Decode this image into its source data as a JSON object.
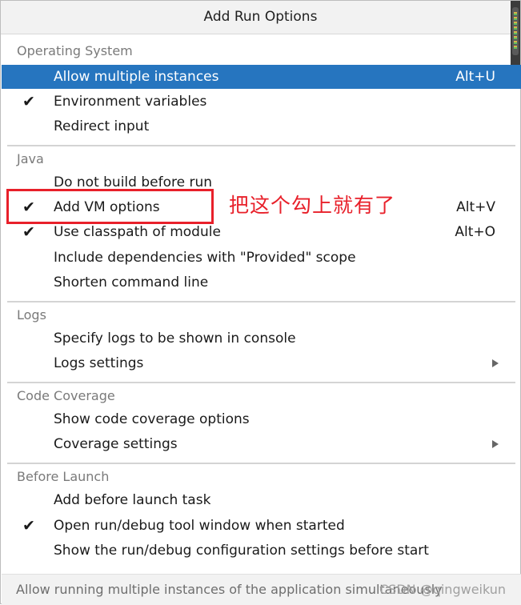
{
  "dialog": {
    "title": "Add Run Options"
  },
  "sections": [
    {
      "header": "Operating System",
      "items": [
        {
          "label": "Allow multiple instances",
          "shortcut": "Alt+U",
          "checked": false,
          "selected": true
        },
        {
          "label": "Environment variables",
          "shortcut": "",
          "checked": true
        },
        {
          "label": "Redirect input",
          "shortcut": "",
          "checked": false
        }
      ]
    },
    {
      "header": "Java",
      "items": [
        {
          "label": "Do not build before run",
          "shortcut": "",
          "checked": false
        },
        {
          "label": "Add VM options",
          "shortcut": "Alt+V",
          "checked": true
        },
        {
          "label": "Use classpath of module",
          "shortcut": "Alt+O",
          "checked": true
        },
        {
          "label": "Include dependencies with \"Provided\" scope",
          "shortcut": "",
          "checked": false
        },
        {
          "label": "Shorten command line",
          "shortcut": "",
          "checked": false
        }
      ]
    },
    {
      "header": "Logs",
      "items": [
        {
          "label": "Specify logs to be shown in console",
          "shortcut": "",
          "checked": false
        },
        {
          "label": "Logs settings",
          "shortcut": "",
          "checked": false,
          "submenu": true
        }
      ]
    },
    {
      "header": "Code Coverage",
      "items": [
        {
          "label": "Show code coverage options",
          "shortcut": "",
          "checked": false
        },
        {
          "label": "Coverage settings",
          "shortcut": "",
          "checked": false,
          "submenu": true
        }
      ]
    },
    {
      "header": "Before Launch",
      "items": [
        {
          "label": "Add before launch task",
          "shortcut": "",
          "checked": false
        },
        {
          "label": "Open run/debug tool window when started",
          "shortcut": "",
          "checked": true
        },
        {
          "label": "Show the run/debug configuration settings before start",
          "shortcut": "",
          "checked": false
        }
      ]
    }
  ],
  "check_glyph": "✔",
  "annotation": {
    "text": "把这个勾上就有了",
    "color": "#e8202a"
  },
  "footer": {
    "text": "Allow running multiple instances of the application simultaneously",
    "watermark": "CSDN @qingweikun"
  },
  "colors": {
    "selection": "#2675bf",
    "section_header": "#7a7a7a"
  }
}
